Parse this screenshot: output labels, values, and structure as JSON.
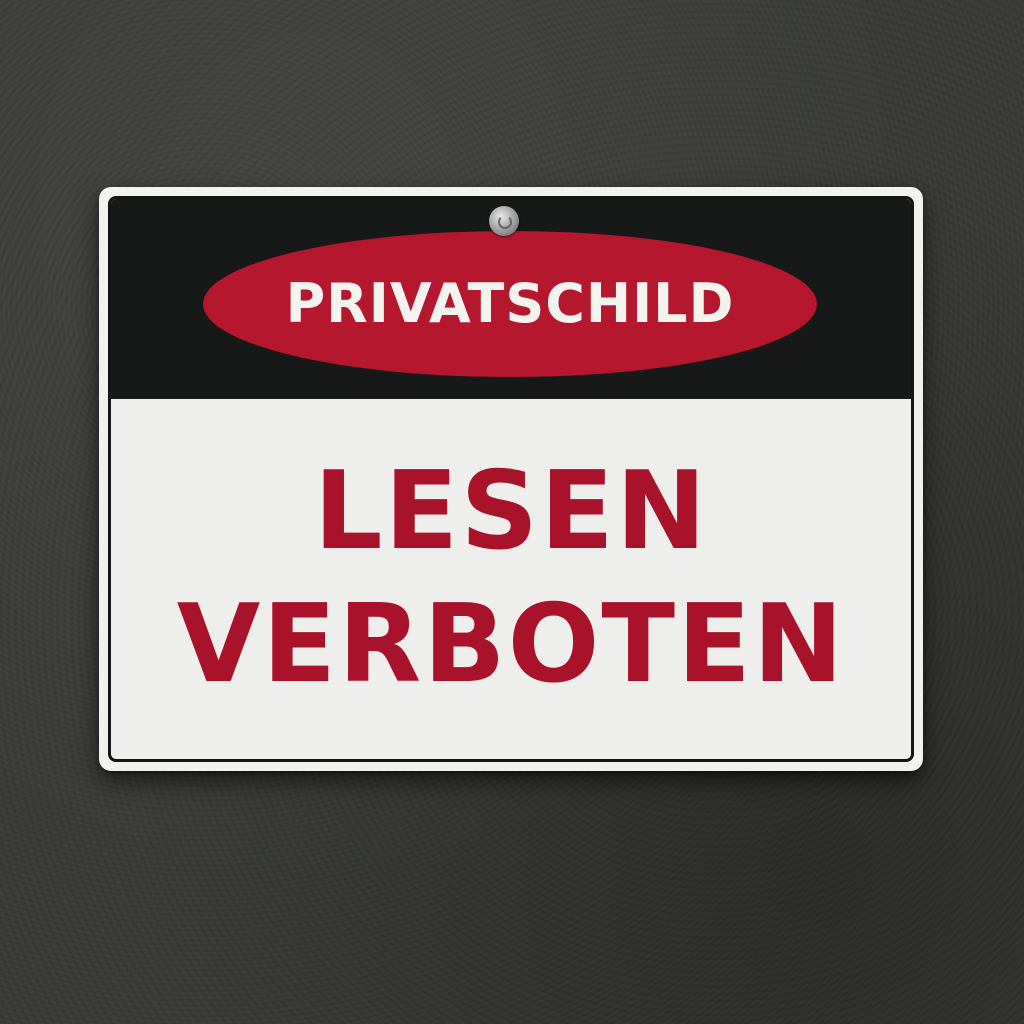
{
  "sign": {
    "header_label": "PRIVATSCHILD",
    "line1": "LESEN",
    "line2": "VERBOTEN"
  },
  "colors": {
    "wall": "#3a3b38",
    "band": "#171818",
    "oval": "#b5172f",
    "text_red": "#a8122a",
    "panel": "#eeeeec"
  }
}
